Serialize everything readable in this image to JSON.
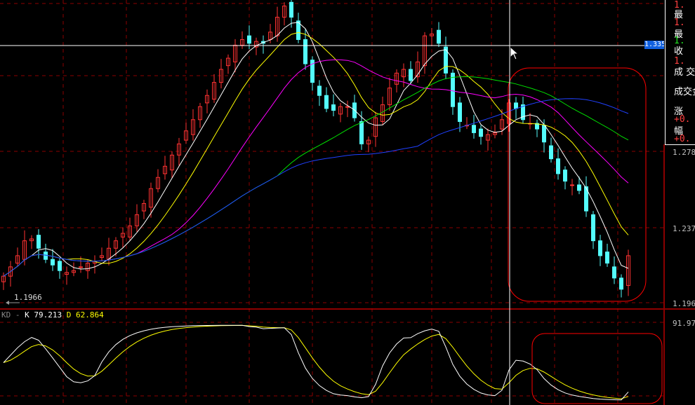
{
  "right_panel": {
    "rows": [
      {
        "text": "1.",
        "color": "#ff4040"
      },
      {
        "text": "最",
        "color": "#ffffff",
        "label": true
      },
      {
        "text": "1.",
        "color": "#ff4040"
      },
      {
        "text": "最",
        "color": "#ffffff",
        "label": true
      },
      {
        "text": "1.",
        "color": "#20e020"
      },
      {
        "text": "收",
        "color": "#ffffff",
        "label": true
      },
      {
        "text": "1.",
        "color": "#ff4040"
      },
      {
        "text": "成 交",
        "color": "#ffffff",
        "label": true
      },
      {
        "text": "成交金",
        "color": "#ffffff",
        "label": true
      },
      {
        "text": "涨",
        "color": "#ffffff",
        "label": true
      },
      {
        "text": "+0.",
        "color": "#ff4040"
      },
      {
        "text": "幅",
        "color": "#ffffff",
        "label": true
      },
      {
        "text": "+0.",
        "color": "#ff4040"
      }
    ]
  },
  "axis": {
    "p1": "1.278",
    "p2": "1.237",
    "p3": "1.196",
    "kd_top": "91.97"
  },
  "crosshair": {
    "price_label": "1.3354"
  },
  "low_label": "1.1966",
  "kd": {
    "name": "KD",
    "sep": "-",
    "k_label": "K",
    "k_value": "79.213",
    "d_label": "D",
    "d_value": "62.864"
  },
  "colors": {
    "up": "#ff3232",
    "down": "#54fcfc",
    "ma5": "#ffffff",
    "ma10": "#ffff00",
    "ma20": "#ff00ff",
    "ma40": "#00e000",
    "ma60": "#2040ff",
    "grid": "#8b0000"
  },
  "chart_data": {
    "type": "candlestick",
    "price_range": [
      1.1966,
      1.3592
    ],
    "closes": [
      1.211,
      1.216,
      1.222,
      1.23,
      1.231,
      1.226,
      1.22,
      1.217,
      1.214,
      1.213,
      1.214,
      1.216,
      1.218,
      1.219,
      1.222,
      1.226,
      1.23,
      1.234,
      1.238,
      1.244,
      1.25,
      1.258,
      1.264,
      1.27,
      1.276,
      1.282,
      1.289,
      1.295,
      1.302,
      1.308,
      1.315,
      1.322,
      1.328,
      1.335,
      1.338,
      1.336,
      1.337,
      1.336,
      1.342,
      1.35,
      1.356,
      1.35,
      1.338,
      1.325,
      1.315,
      1.308,
      1.301,
      1.3,
      1.302,
      1.302,
      1.296,
      1.282,
      1.284,
      1.296,
      1.303,
      1.312,
      1.32,
      1.322,
      1.316,
      1.326,
      1.34,
      1.341,
      1.336,
      1.32,
      1.302,
      1.294,
      1.292,
      1.288,
      1.286,
      1.287,
      1.288,
      1.295,
      1.304,
      1.301,
      1.295,
      1.293,
      1.29,
      1.283,
      1.274,
      1.266,
      1.262,
      1.26,
      1.257,
      1.246,
      1.23,
      1.222,
      1.218,
      1.21,
      1.204,
      1.222
    ],
    "ma_periods": [
      5,
      10,
      20,
      40,
      60
    ],
    "kd_range": [
      0,
      100
    ]
  }
}
